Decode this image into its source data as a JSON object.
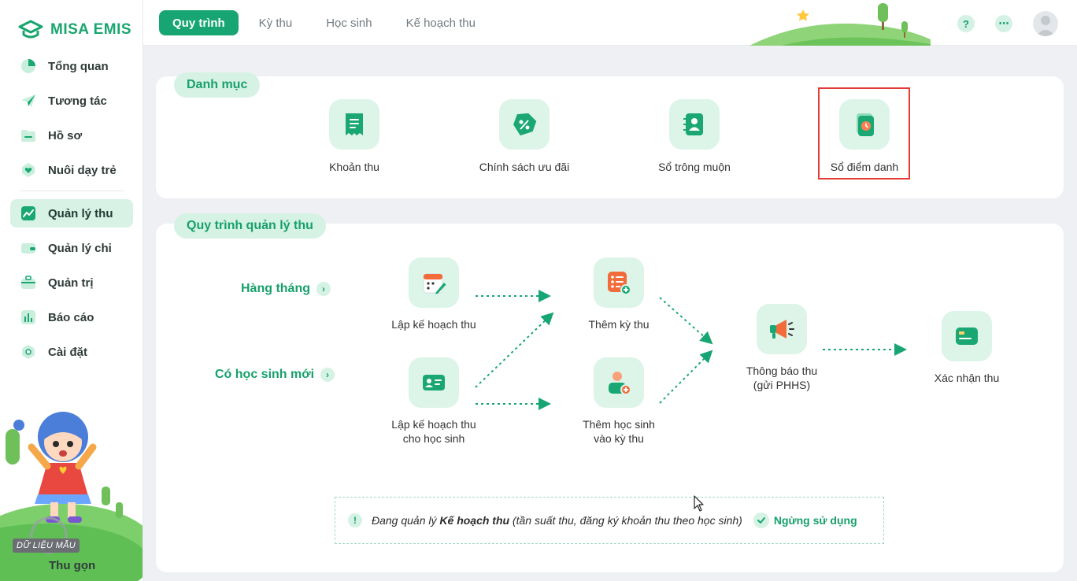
{
  "app": {
    "brand": "MISA EMIS"
  },
  "sidebar": {
    "items": [
      {
        "label": "Tổng quan",
        "icon": "pie-chart-icon"
      },
      {
        "label": "Tương tác",
        "icon": "paper-plane-icon"
      },
      {
        "label": "Hồ sơ",
        "icon": "folder-icon"
      },
      {
        "label": "Nuôi dạy trẻ",
        "icon": "heart-icon"
      },
      {
        "label": "Quản lý thu",
        "icon": "trend-chart-icon",
        "active": true
      },
      {
        "label": "Quản lý chi",
        "icon": "wallet-icon"
      },
      {
        "label": "Quản trị",
        "icon": "briefcase-icon"
      },
      {
        "label": "Báo cáo",
        "icon": "bar-chart-icon"
      },
      {
        "label": "Cài đặt",
        "icon": "gear-icon"
      }
    ],
    "collapse_label": "Thu gọn",
    "sample_badge": "DỮ LIỆU MẪU"
  },
  "topbar": {
    "tabs": [
      {
        "label": "Quy trình",
        "active": true
      },
      {
        "label": "Kỳ thu"
      },
      {
        "label": "Học sinh"
      },
      {
        "label": "Kế hoạch thu"
      }
    ],
    "help_icon": "?",
    "more_icon": "⋯"
  },
  "categories": {
    "title": "Danh mục",
    "items": [
      {
        "label": "Khoản thu",
        "icon": "receipt-icon"
      },
      {
        "label": "Chính sách ưu đãi",
        "icon": "discount-tag-icon"
      },
      {
        "label": "Sổ trông muộn",
        "icon": "contact-book-icon"
      },
      {
        "label": "Sổ điểm danh",
        "icon": "attendance-book-icon",
        "highlighted": true
      }
    ]
  },
  "process": {
    "title": "Quy trình quản lý thu",
    "rows": [
      {
        "label": "Hàng tháng"
      },
      {
        "label": "Có học sinh mới"
      }
    ],
    "steps": {
      "plan": "Lập kế hoạch thu",
      "plan_student_1": "Lập kế hoạch thu",
      "plan_student_2": "cho học sinh",
      "add_period": "Thêm kỳ thu",
      "add_student_1": "Thêm học sinh",
      "add_student_2": "vào kỳ thu",
      "notify_1": "Thông báo thu",
      "notify_2": "(gửi PHHS)",
      "confirm": "Xác nhận thu"
    },
    "note": {
      "prefix": "Đang quản lý ",
      "bold": "Kế hoạch thu",
      "suffix": " (tần suất thu, đăng ký khoản thu theo học sinh)",
      "action": "Ngừng sử dụng"
    }
  },
  "colors": {
    "accent": "#17a673",
    "accent_light": "#d6f2e5",
    "highlight": "#e53935",
    "orange": "#f26b3a"
  }
}
